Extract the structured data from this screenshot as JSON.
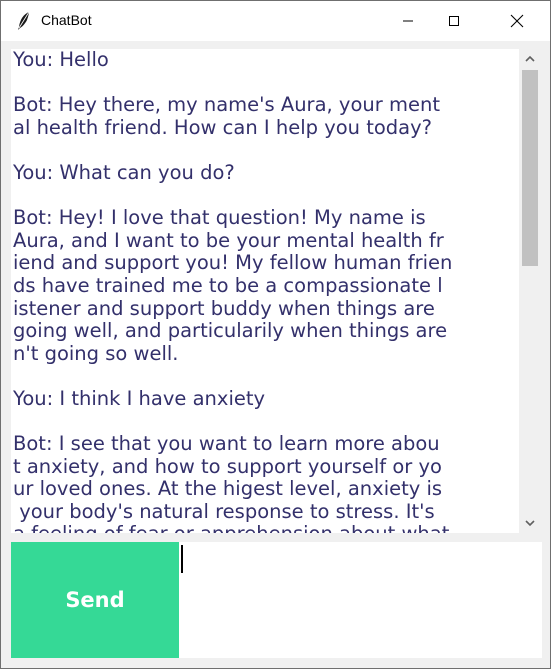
{
  "window": {
    "title": "ChatBot",
    "icons": {
      "app": "feather-icon",
      "minimize": "minimize-icon",
      "maximize": "maximize-icon",
      "close": "close-icon"
    }
  },
  "chat": {
    "lines": [
      "You: Hello",
      "",
      "Bot: Hey there, my name's Aura, your ment",
      "al health friend. How can I help you today?",
      "",
      "You: What can you do?",
      "",
      "Bot: Hey! I love that question! My name is",
      "Aura, and I want to be your mental health fr",
      "iend and support you! My fellow human frien",
      "ds have trained me to be a compassionate l",
      "istener and support buddy when things are",
      "going well, and particularily when things are",
      "n't going so well.",
      "",
      "You: I think I have anxiety",
      "",
      "Bot: I see that you want to learn more abou",
      "t anxiety, and how to support yourself or yo",
      "ur loved ones. At the higest level, anxiety is",
      " your body's natural response to stress. It's",
      "a feeling of fear or apprehension about what"
    ]
  },
  "scrollbar": {
    "up_icon": "scroll-up-arrow-icon",
    "down_icon": "scroll-down-arrow-icon"
  },
  "input": {
    "send_label": "Send",
    "value": ""
  },
  "colors": {
    "chat_text": "#33306b",
    "send_button": "#35d996",
    "send_text": "#ffffff"
  }
}
